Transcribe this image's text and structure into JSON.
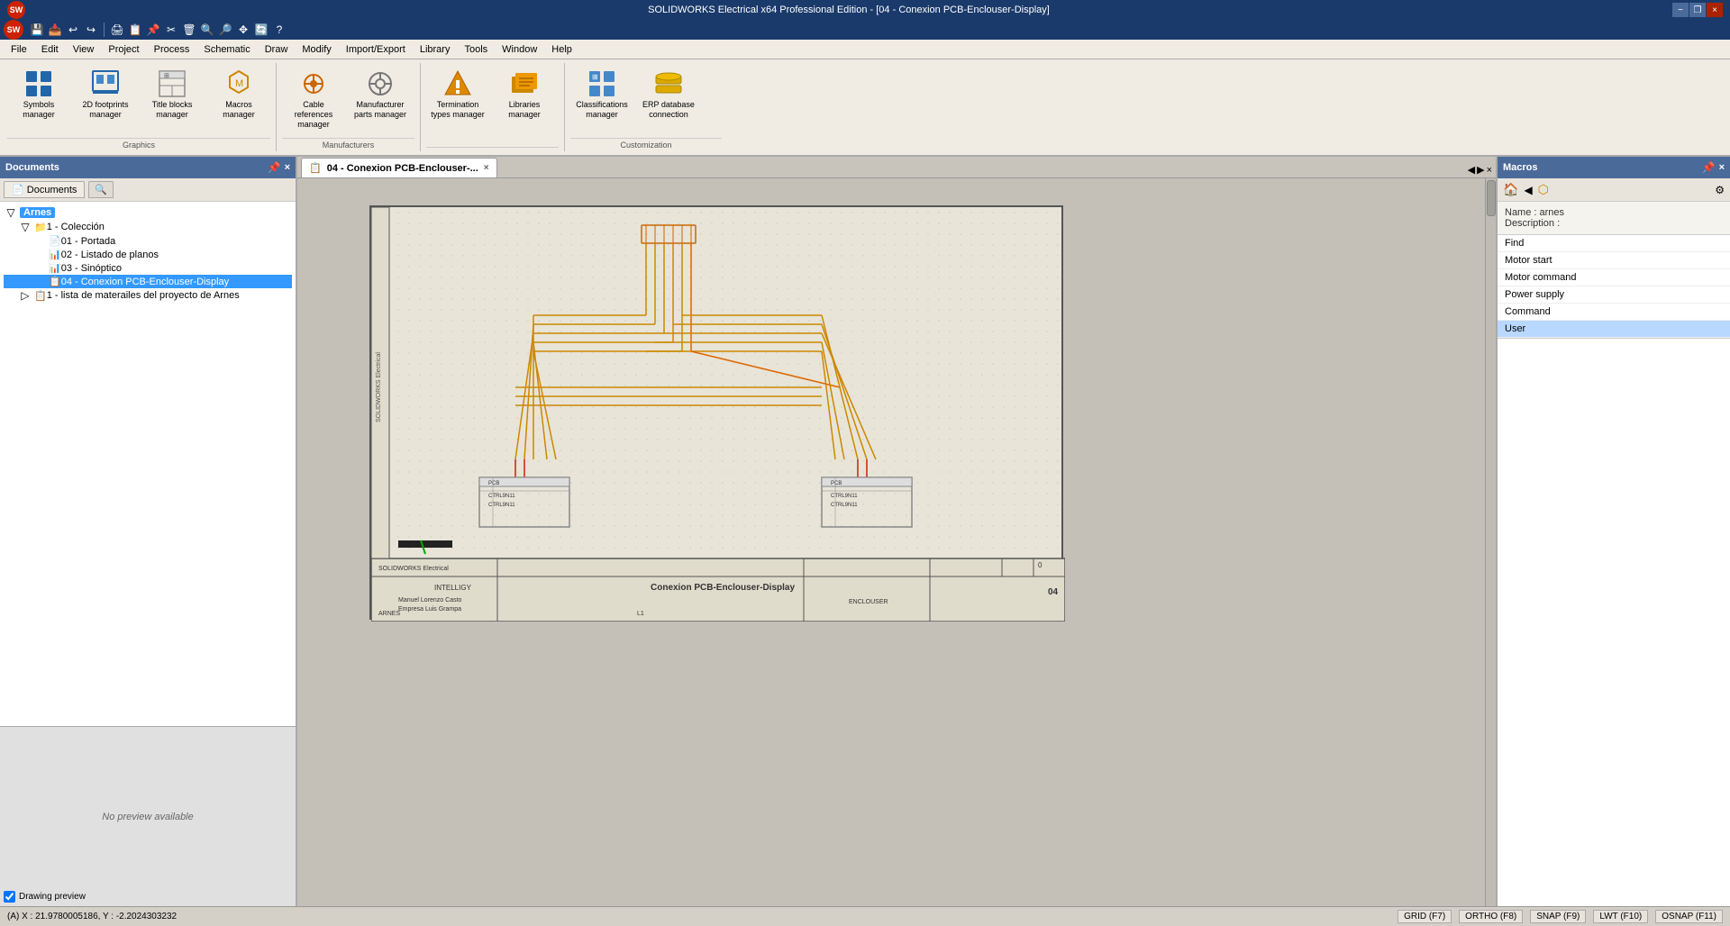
{
  "app": {
    "title": "SOLIDWORKS Electrical x64 Professional Edition - [04 - Conexion PCB-Enclouser-Display]",
    "minimize_label": "−",
    "maximize_label": "□",
    "close_label": "×",
    "restore_label": "❐"
  },
  "menubar": {
    "items": [
      "File",
      "Edit",
      "View",
      "Project",
      "Process",
      "Schematic",
      "Draw",
      "Modify",
      "Import/Export",
      "Library",
      "Tools",
      "Window",
      "Help"
    ]
  },
  "toolbar": {
    "groups": [
      {
        "label": "Graphics",
        "items": [
          {
            "id": "symbols-manager",
            "icon": "⊞",
            "label": "Symbols\nmanager"
          },
          {
            "id": "footprints-manager",
            "icon": "◫",
            "label": "2D footprints\nmanager"
          },
          {
            "id": "title-blocks-manager",
            "icon": "⊡",
            "label": "Title blocks\nmanager"
          },
          {
            "id": "macros-manager",
            "icon": "⬡",
            "label": "Macros\nmanager"
          }
        ]
      },
      {
        "label": "Manufacturers",
        "items": [
          {
            "id": "cable-references",
            "icon": "🔌",
            "label": "Cable references\nmanager"
          },
          {
            "id": "manufacturer-parts",
            "icon": "⚙",
            "label": "Manufacturer\nparts manager"
          }
        ]
      },
      {
        "label": "",
        "items": [
          {
            "id": "termination-types",
            "icon": "🔶",
            "label": "Termination\ntypes manager"
          },
          {
            "id": "libraries-manager",
            "icon": "📚",
            "label": "Libraries\nmanager"
          }
        ]
      },
      {
        "label": "Customization",
        "items": [
          {
            "id": "classifications",
            "icon": "⊞",
            "label": "Classifications\nmanager"
          },
          {
            "id": "erp-database",
            "icon": "🔷",
            "label": "ERP database\nconnection"
          }
        ]
      }
    ]
  },
  "documents_panel": {
    "title": "Documents",
    "pin_label": "📌",
    "close_label": "×",
    "tabs": [
      {
        "id": "documents-tab",
        "label": "Documents",
        "icon": "📄"
      },
      {
        "id": "search-tab",
        "icon": "🔍",
        "label": ""
      }
    ],
    "tree": {
      "root": {
        "id": "arnes",
        "label": "Arnes",
        "icon": "📁",
        "expanded": true,
        "children": [
          {
            "id": "coleccion",
            "label": "1 - Colección",
            "icon": "📁",
            "expanded": true,
            "children": [
              {
                "id": "portada",
                "label": "01 - Portada",
                "icon": "📄"
              },
              {
                "id": "listado",
                "label": "02 - Listado de planos",
                "icon": "📊"
              },
              {
                "id": "sinoptico",
                "label": "03 - Sinóptico",
                "icon": "📊"
              },
              {
                "id": "conexion",
                "label": "04 - Conexion PCB-Enclouser-Display",
                "icon": "📋",
                "selected": true
              }
            ]
          },
          {
            "id": "materiales",
            "label": "1 - lista de materailes del proyecto de Arnes",
            "icon": "📋",
            "expanded": false
          }
        ]
      }
    }
  },
  "preview_panel": {
    "no_preview_text": "No preview available",
    "checkbox_label": "Drawing preview",
    "checked": true
  },
  "canvas": {
    "tab_label": "04 - Conexion PCB-Enclouser-...",
    "tab_close": "×",
    "drawing_title": "Conexion PCB-Enclouser-Display",
    "company": "INTELLIGY",
    "sheet": "L1",
    "enclosure": "ENCLOUSER",
    "page_num": "04"
  },
  "macros_panel": {
    "title": "Macros",
    "pin_label": "📌",
    "close_label": "×",
    "home_icon": "🏠",
    "back_icon": "◀",
    "macros_icon": "⬡",
    "settings_icon": "⚙",
    "name_label": "Name : arnes",
    "description_label": "Description :",
    "items": [
      {
        "id": "find",
        "label": "Find"
      },
      {
        "id": "motor-start",
        "label": "Motor start"
      },
      {
        "id": "motor-command",
        "label": "Motor command"
      },
      {
        "id": "power-supply",
        "label": "Power supply"
      },
      {
        "id": "command",
        "label": "Command"
      },
      {
        "id": "user",
        "label": "User",
        "selected": true
      }
    ],
    "search_placeholder": ""
  },
  "statusbar": {
    "coord_text": "(A) X : 21.9780005186, Y : -2.2024303232",
    "grid_label": "GRID (F7)",
    "ortho_label": "ORTHO (F8)",
    "snap_label": "SNAP (F9)",
    "lwt_label": "LWT (F10)",
    "osnap_label": "OSNAP (F11)"
  },
  "icons": {
    "expand": "▷",
    "collapse": "▽",
    "folder": "📁",
    "document": "📄",
    "grid": "▦",
    "page": "📋"
  }
}
